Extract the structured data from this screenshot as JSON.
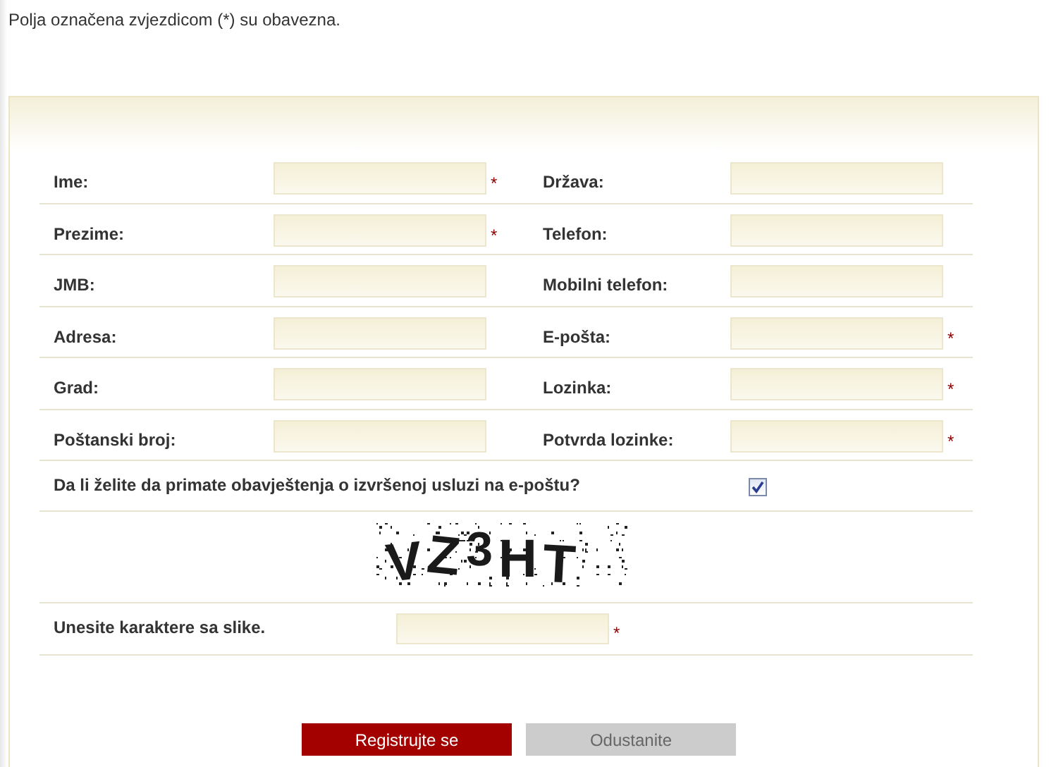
{
  "notice": "Polja označena zvjezdicom (*) su obavezna.",
  "rows": [
    {
      "left": {
        "label": "Ime:",
        "required_mark": "*"
      },
      "right": {
        "label": "Država:"
      }
    },
    {
      "left": {
        "label": "Prezime:",
        "required_mark": "*"
      },
      "right": {
        "label": "Telefon:"
      }
    },
    {
      "left": {
        "label": "JMB:"
      },
      "right": {
        "label": "Mobilni telefon:"
      }
    },
    {
      "left": {
        "label": "Adresa:"
      },
      "right": {
        "label": "E-pošta:",
        "required_mark": "*"
      }
    },
    {
      "left": {
        "label": "Grad:"
      },
      "right": {
        "label": "Lozinka:",
        "required_mark": "*"
      }
    },
    {
      "left": {
        "label": "Poštanski broj:"
      },
      "right": {
        "label": "Potvrda lozinke:",
        "required_mark": "*"
      }
    }
  ],
  "newsletter": {
    "label": "Da li želite da primate obavještenja o izvršenoj usluzi na e-poštu?",
    "checked": true
  },
  "captcha": {
    "text": "VZ3HT"
  },
  "captcha_field": {
    "label": "Unesite karaktere sa slike.",
    "required_mark": "*"
  },
  "buttons": [
    {
      "label": "Registrujte se",
      "kind": "primary"
    },
    {
      "label": "Odustanite",
      "kind": "secondary"
    }
  ]
}
